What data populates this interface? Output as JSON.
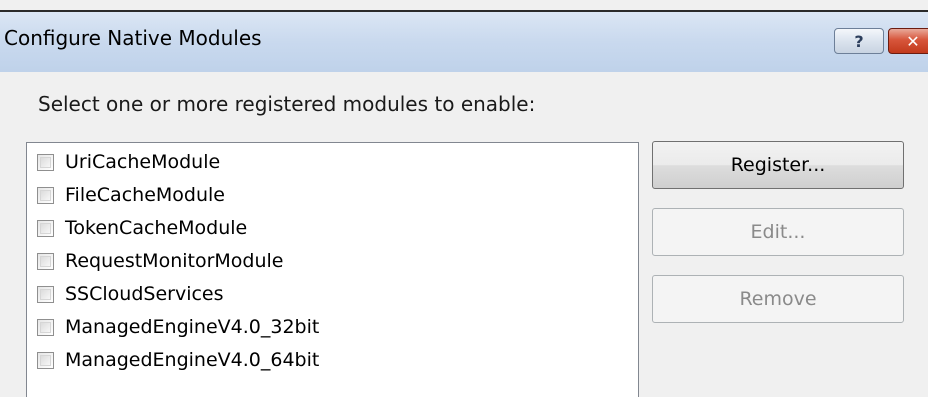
{
  "window": {
    "title": "Configure Native Modules",
    "help_label": "?",
    "close_label": "✕"
  },
  "instruction": "Select one or more registered modules to enable:",
  "modules": [
    {
      "label": "UriCacheModule",
      "checked": false
    },
    {
      "label": "FileCacheModule",
      "checked": false
    },
    {
      "label": "TokenCacheModule",
      "checked": false
    },
    {
      "label": "RequestMonitorModule",
      "checked": false
    },
    {
      "label": "SSCloudServices",
      "checked": false
    },
    {
      "label": "ManagedEngineV4.0_32bit",
      "checked": false
    },
    {
      "label": "ManagedEngineV4.0_64bit",
      "checked": false
    }
  ],
  "buttons": {
    "register": {
      "label": "Register...",
      "enabled": true
    },
    "edit": {
      "label": "Edit...",
      "enabled": false
    },
    "remove": {
      "label": "Remove",
      "enabled": false
    }
  },
  "colors": {
    "titlebar": "#c9d9ee",
    "close_button": "#c23a1c",
    "dialog_background": "#f0f0f0",
    "disabled_text": "#8a8a8a"
  }
}
